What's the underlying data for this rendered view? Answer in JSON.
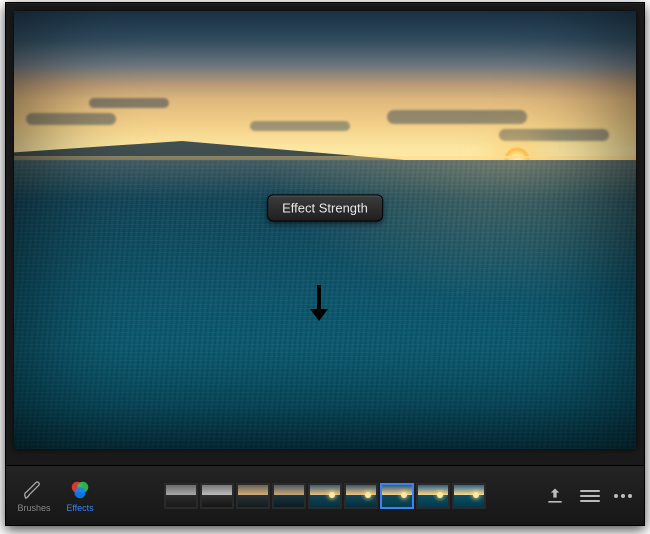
{
  "tooltip": {
    "label": "Effect Strength"
  },
  "toolbar": {
    "tabs": [
      {
        "id": "brushes",
        "label": "Brushes",
        "active": false
      },
      {
        "id": "effects",
        "label": "Effects",
        "active": true
      }
    ],
    "thumbs": [
      {
        "id": 0,
        "selected": false,
        "sky": "linear-gradient(to bottom,#6b6b6b,#a8a8a8)",
        "sea": "linear-gradient(to bottom,#2b2b2b,#1a1a1a)",
        "sun": false
      },
      {
        "id": 1,
        "selected": false,
        "sky": "linear-gradient(to bottom,#777,#bcbcbc)",
        "sea": "linear-gradient(to bottom,#2f2f2f,#151515)",
        "sun": false
      },
      {
        "id": 2,
        "selected": false,
        "sky": "linear-gradient(to bottom,#6a6358,#cfae7b)",
        "sea": "linear-gradient(to bottom,#2a3238,#141b1f)",
        "sun": false
      },
      {
        "id": 3,
        "selected": false,
        "sky": "linear-gradient(to bottom,#4f5a63,#c9a876)",
        "sea": "linear-gradient(to bottom,#1c3542,#0c1a21)",
        "sun": false
      },
      {
        "id": 4,
        "selected": false,
        "sky": "linear-gradient(to bottom,#3c5a72,#e9c082)",
        "sea": "linear-gradient(to bottom,#134457,#06303f)",
        "sun": true
      },
      {
        "id": 5,
        "selected": false,
        "sky": "linear-gradient(to bottom,#3a5670,#f0c77f)",
        "sea": "linear-gradient(to bottom,#12485c,#052d3a)",
        "sun": true
      },
      {
        "id": 6,
        "selected": true,
        "sky": "linear-gradient(to bottom,#2f5a7c,#f6d28a)",
        "sea": "linear-gradient(to bottom,#0f4a5e,#053b4c)",
        "sun": true
      },
      {
        "id": 7,
        "selected": false,
        "sky": "linear-gradient(to bottom,#2b5f86,#f9d88e)",
        "sea": "linear-gradient(to bottom,#0d4e64,#04394a)",
        "sun": true
      },
      {
        "id": 8,
        "selected": false,
        "sky": "linear-gradient(to bottom,#2a628c,#fbdc92)",
        "sea": "linear-gradient(to bottom,#0c526a,#033746)",
        "sun": true
      }
    ],
    "icons": {
      "brush": "brush-icon",
      "effects": "rgb-circles-icon",
      "export": "export-icon",
      "menu": "menu-icon",
      "more": "more-icon"
    }
  }
}
